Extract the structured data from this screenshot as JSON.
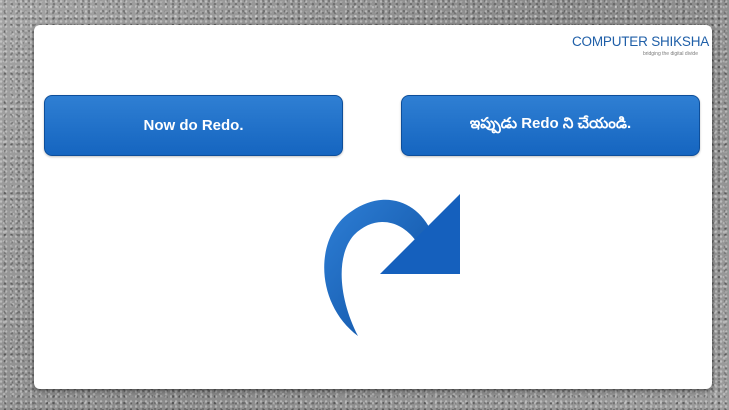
{
  "logo": {
    "text": "COMPUTER SHIKSHA",
    "tagline": "bridging the digital divide"
  },
  "instruction_en": "Now do Redo.",
  "instruction_te": "ఇప్పుడు Redo ని చేయండి.",
  "icons": {
    "redo": "redo-arrow-icon"
  },
  "colors": {
    "box_blue": "#1e6fc8",
    "arrow_blue": "#1565c0",
    "logo_blue": "#1f5fa8"
  }
}
